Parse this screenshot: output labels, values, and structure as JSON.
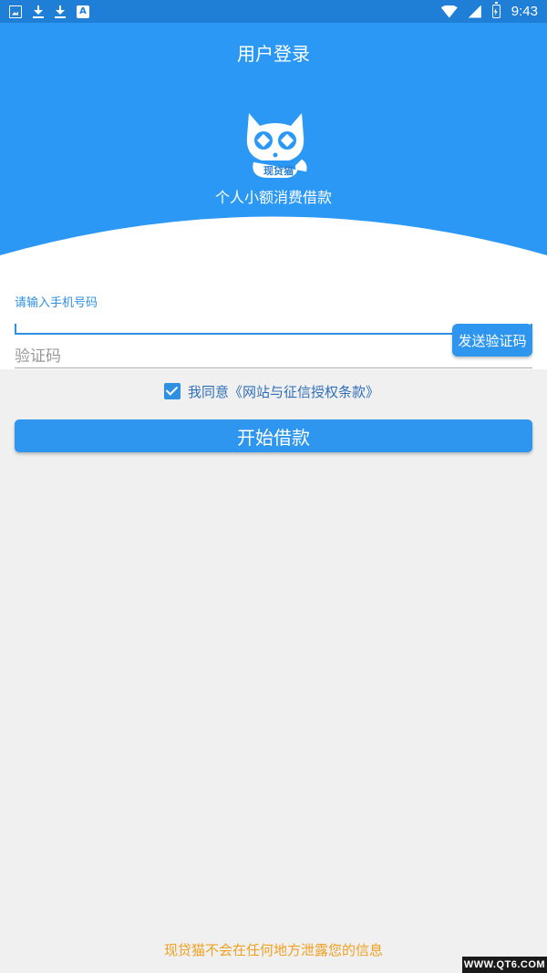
{
  "status_bar": {
    "time": "9:43",
    "left_icons": [
      "image-icon",
      "download-icon",
      "download-icon",
      "a-icon"
    ],
    "right_icons": [
      "wifi-icon",
      "signal-icon",
      "battery-charging-icon"
    ]
  },
  "header": {
    "title": "用户登录",
    "logo_text": "现贷猫",
    "slogan": "个人小额消费借款",
    "bg_color": "#2b98f5"
  },
  "form": {
    "phone_label": "请输入手机号码",
    "phone_value": "",
    "code_placeholder": "验证码",
    "code_value": "",
    "send_code_label": "发送验证码",
    "agree_text": "我同意《网站与征信授权条款》",
    "agree_checked": true,
    "submit_label": "开始借款"
  },
  "footer": {
    "note": "现贷猫不会在任何地方泄露您的信息",
    "watermark": "WWW.QT6.COM"
  },
  "colors": {
    "accent": "#2f96f0",
    "footer_note": "#f0a020"
  }
}
